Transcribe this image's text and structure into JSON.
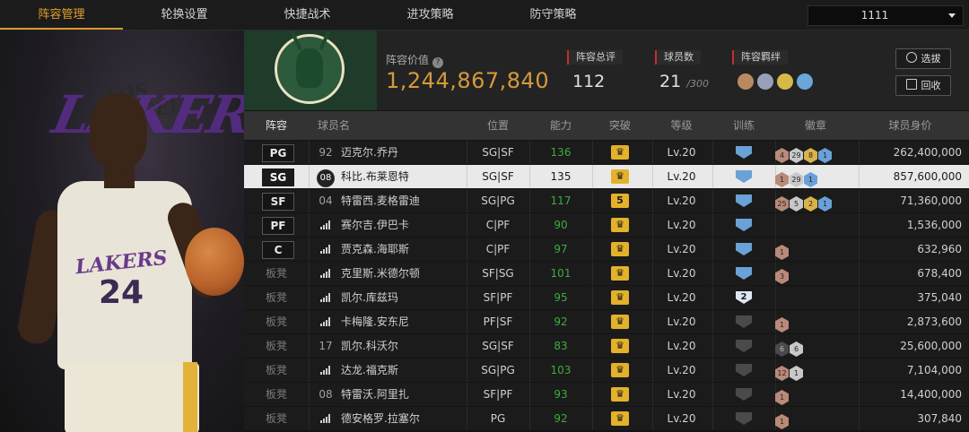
{
  "tabs": [
    {
      "label": "阵容管理",
      "active": true
    },
    {
      "label": "轮换设置",
      "active": false
    },
    {
      "label": "快捷战术",
      "active": false
    },
    {
      "label": "进攻策略",
      "active": false
    },
    {
      "label": "防守策略",
      "active": false
    }
  ],
  "selector": {
    "value": "1111"
  },
  "info": {
    "lineup_value_label": "阵容价值",
    "lineup_value": "1,244,867,840",
    "rating_label": "阵容总评",
    "rating_value": "112",
    "players_label": "球员数",
    "players_value": "21",
    "players_max": "/300",
    "bond_label": "阵容羁绊",
    "choose_button": "选拔",
    "recycle_button": "回收"
  },
  "player_art": {
    "team_word": "LAKERS",
    "team_word_top": "LOS ANGELES",
    "jersey_name": "LAKERS",
    "jersey_number": "24"
  },
  "columns": [
    "阵容",
    "球员名",
    "位置",
    "能力",
    "突破",
    "等级",
    "训练",
    "徽章",
    "球员身价"
  ],
  "rows": [
    {
      "slot": "PG",
      "starter": true,
      "num": "92",
      "name": "迈克尔.乔丹",
      "pos": "SG|SF",
      "ability": "136",
      "breakthrough": "",
      "level": "Lv.20",
      "train": "blue",
      "badges": [
        [
          "bronze",
          "4"
        ],
        [
          "silver",
          "29"
        ],
        [
          "gold",
          "8"
        ],
        [
          "blue",
          "1"
        ]
      ],
      "value": "262,400,000",
      "selected": false
    },
    {
      "slot": "SG",
      "starter": true,
      "num": "08",
      "numbadge": true,
      "name": "科比.布莱恩特",
      "pos": "SG|SF",
      "ability": "135",
      "breakthrough": "",
      "level": "Lv.20",
      "train": "blue",
      "badges": [
        [
          "bronze",
          "1"
        ],
        [
          "silver",
          "29"
        ],
        [
          "blue",
          "1"
        ]
      ],
      "value": "857,600,000",
      "selected": true
    },
    {
      "slot": "SF",
      "starter": true,
      "num": "04",
      "name": "特雷西.麦格雷迪",
      "pos": "SG|PG",
      "ability": "117",
      "breakthrough": "5",
      "level": "Lv.20",
      "train": "blue",
      "badges": [
        [
          "bronze",
          "25"
        ],
        [
          "silver",
          "5"
        ],
        [
          "gold",
          "2"
        ],
        [
          "blue",
          "1"
        ]
      ],
      "value": "71,360,000",
      "selected": false
    },
    {
      "slot": "PF",
      "starter": true,
      "num": "",
      "name": "赛尔吉.伊巴卡",
      "pos": "C|PF",
      "ability": "90",
      "breakthrough": "",
      "level": "Lv.20",
      "train": "blue",
      "badges": [],
      "value": "1,536,000",
      "selected": false
    },
    {
      "slot": "C",
      "starter": true,
      "num": "",
      "name": "贾克森.海耶斯",
      "pos": "C|PF",
      "ability": "97",
      "breakthrough": "",
      "level": "Lv.20",
      "train": "blue",
      "badges": [
        [
          "bronze",
          "1"
        ]
      ],
      "value": "632,960",
      "selected": false
    },
    {
      "slot": "板凳",
      "starter": false,
      "num": "",
      "name": "克里斯.米德尔顿",
      "pos": "SF|SG",
      "ability": "101",
      "breakthrough": "",
      "level": "Lv.20",
      "train": "blue",
      "badges": [
        [
          "bronze",
          "3"
        ]
      ],
      "value": "678,400",
      "selected": false
    },
    {
      "slot": "板凳",
      "starter": false,
      "num": "",
      "name": "凯尔.库兹玛",
      "pos": "SF|PF",
      "ability": "95",
      "breakthrough": "",
      "level": "Lv.20",
      "train": "num2",
      "badges": [],
      "value": "375,040",
      "selected": false
    },
    {
      "slot": "板凳",
      "starter": false,
      "num": "",
      "name": "卡梅隆.安东尼",
      "pos": "PF|SF",
      "ability": "92",
      "breakthrough": "",
      "level": "Lv.20",
      "train": "dim",
      "badges": [
        [
          "bronze",
          "1"
        ]
      ],
      "value": "2,873,600",
      "selected": false
    },
    {
      "slot": "板凳",
      "starter": false,
      "num": "17",
      "name": "凯尔.科沃尔",
      "pos": "SG|SF",
      "ability": "83",
      "breakthrough": "",
      "level": "Lv.20",
      "train": "dim",
      "badges": [
        [
          "dark",
          "6"
        ],
        [
          "silver",
          "6"
        ]
      ],
      "value": "25,600,000",
      "selected": false
    },
    {
      "slot": "板凳",
      "starter": false,
      "num": "",
      "name": "达龙.福克斯",
      "pos": "SG|PG",
      "ability": "103",
      "breakthrough": "",
      "level": "Lv.20",
      "train": "dim",
      "badges": [
        [
          "bronze",
          "12"
        ],
        [
          "silver",
          "1"
        ]
      ],
      "value": "7,104,000",
      "selected": false
    },
    {
      "slot": "板凳",
      "starter": false,
      "num": "08",
      "name": "特雷沃.阿里扎",
      "pos": "SF|PF",
      "ability": "93",
      "breakthrough": "",
      "level": "Lv.20",
      "train": "dim",
      "badges": [
        [
          "bronze",
          "1"
        ]
      ],
      "value": "14,400,000",
      "selected": false
    },
    {
      "slot": "板凳",
      "starter": false,
      "num": "",
      "name": "德安格罗.拉塞尔",
      "pos": "PG",
      "ability": "92",
      "breakthrough": "",
      "level": "Lv.20",
      "train": "dim",
      "badges": [
        [
          "bronze",
          "1"
        ]
      ],
      "value": "307,840",
      "selected": false
    }
  ],
  "colors": {
    "accent": "#d89a2a",
    "value_gold": "#d49a3b",
    "stat_red": "#c62d2d",
    "ability_green": "#3faa3f",
    "crown_gold": "#e3b12a",
    "train_blue": "#6aa1d6"
  }
}
